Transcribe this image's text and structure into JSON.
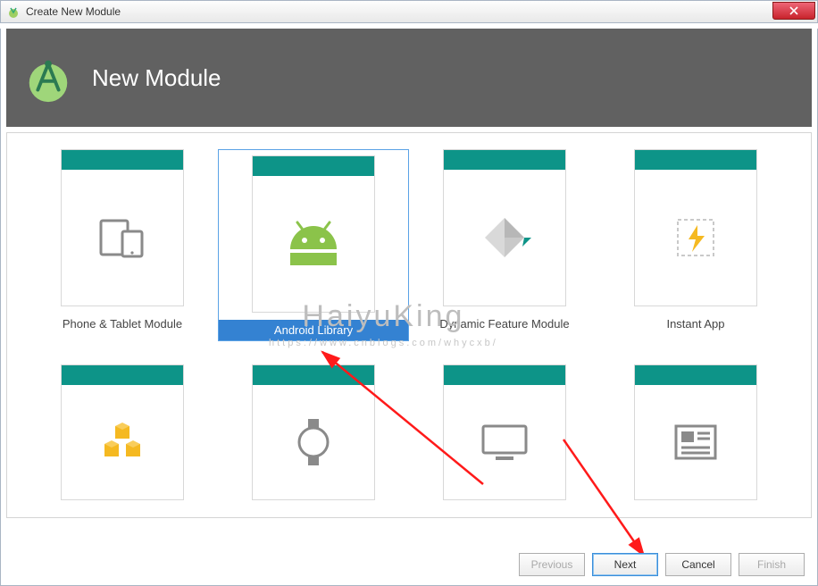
{
  "window": {
    "title": "Create New Module"
  },
  "header": {
    "title": "New Module"
  },
  "modules": {
    "row1": [
      {
        "label": "Phone & Tablet Module",
        "icon": "devices"
      },
      {
        "label": "Android Library",
        "icon": "android",
        "selected": true
      },
      {
        "label": "Dynamic Feature Module",
        "icon": "diamond"
      },
      {
        "label": "Instant App",
        "icon": "lightning"
      }
    ],
    "row2": [
      {
        "label": "",
        "icon": "packages"
      },
      {
        "label": "",
        "icon": "watch"
      },
      {
        "label": "",
        "icon": "tv"
      },
      {
        "label": "",
        "icon": "newspaper"
      }
    ]
  },
  "buttons": {
    "previous": "Previous",
    "next": "Next",
    "cancel": "Cancel",
    "finish": "Finish"
  },
  "watermark": {
    "line1": "HaiyuKing",
    "line2": "https://www.cnblogs.com/whycxb/"
  }
}
